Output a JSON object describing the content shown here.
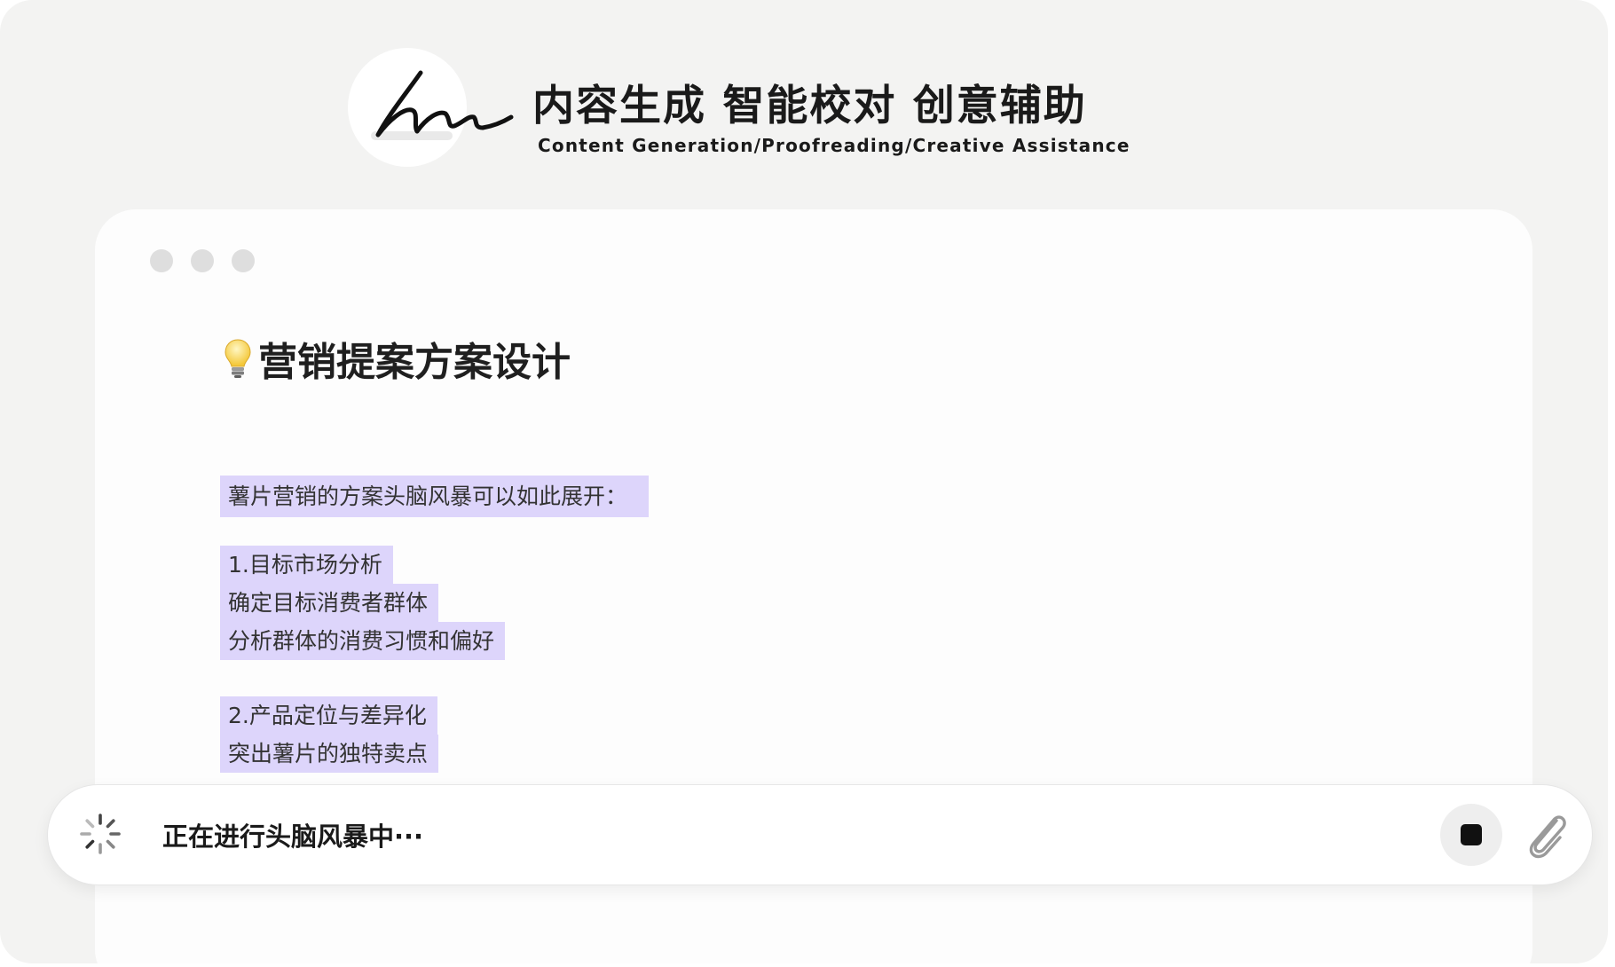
{
  "header": {
    "title": "内容生成 智能校对 创意辅助",
    "subtitle": "Content Generation/Proofreading/Creative Assistance",
    "logo_icon": "signature-logo-icon"
  },
  "document": {
    "title": "营销提案方案设计",
    "title_icon": "lightbulb-icon",
    "highlight_color": "#ddd5fb",
    "paragraphs": [
      {
        "lines": [
          "薯片营销的方案头脑风暴可以如此展开："
        ]
      },
      {
        "lines": [
          "1.目标市场分析",
          "确定目标消费者群体",
          "分析群体的消费习惯和偏好"
        ]
      },
      {
        "lines": [
          "2.产品定位与差异化",
          "突出薯片的独特卖点"
        ]
      }
    ]
  },
  "input_bar": {
    "status_icon": "loading-spinner-icon",
    "status_text": "正在进行头脑风暴中···",
    "stop_icon": "stop-icon",
    "attach_icon": "paperclip-icon"
  }
}
